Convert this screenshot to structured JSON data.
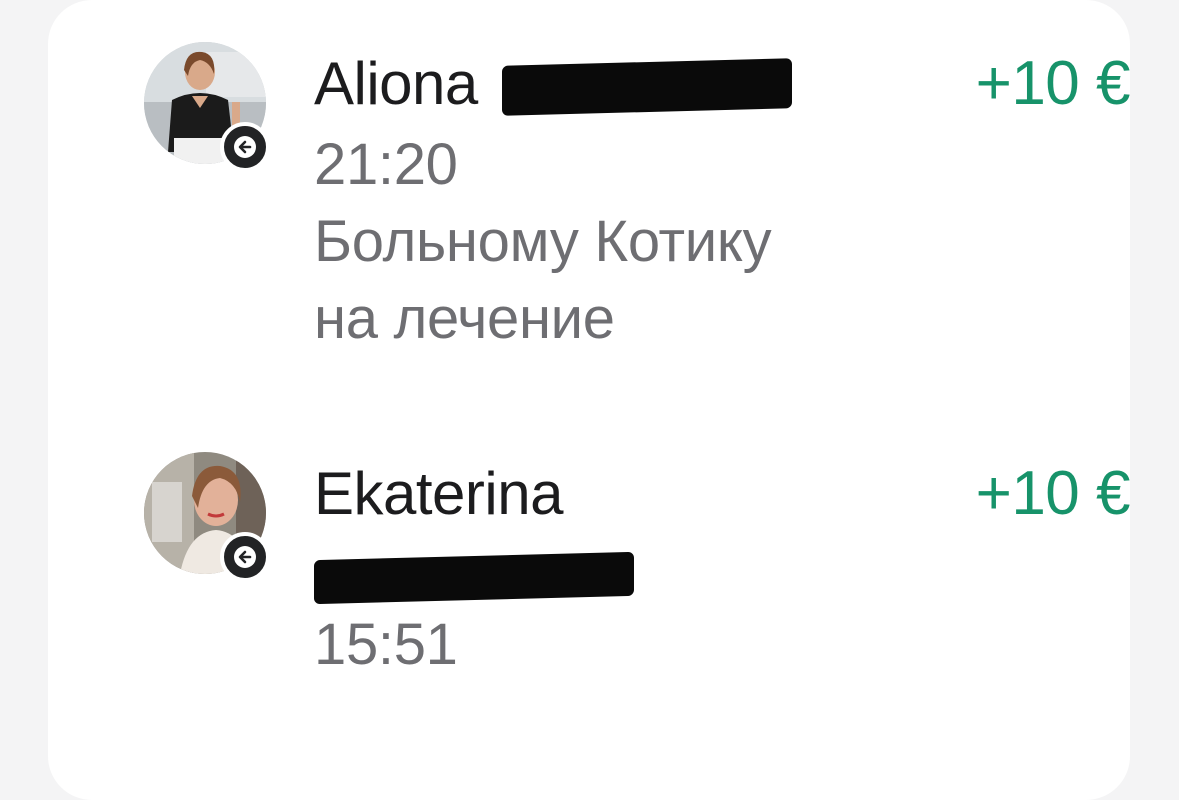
{
  "colors": {
    "background": "#f4f4f5",
    "card": "#ffffff",
    "name_text": "#1c1c1e",
    "secondary_text": "#6e6e72",
    "incoming_amount": "#17936a",
    "direction_badge": "#222325"
  },
  "transactions": [
    {
      "first_name": "Aliona",
      "last_name_redacted": true,
      "time": "21:20",
      "note_line1": "Больному Котику",
      "note_line2": "на лечение",
      "amount": "+10 €",
      "direction_icon": "arrow-left-icon"
    },
    {
      "first_name": "Ekaterina",
      "last_name_redacted": true,
      "time": "15:51",
      "amount": "+10 €",
      "direction_icon": "arrow-left-icon"
    }
  ]
}
